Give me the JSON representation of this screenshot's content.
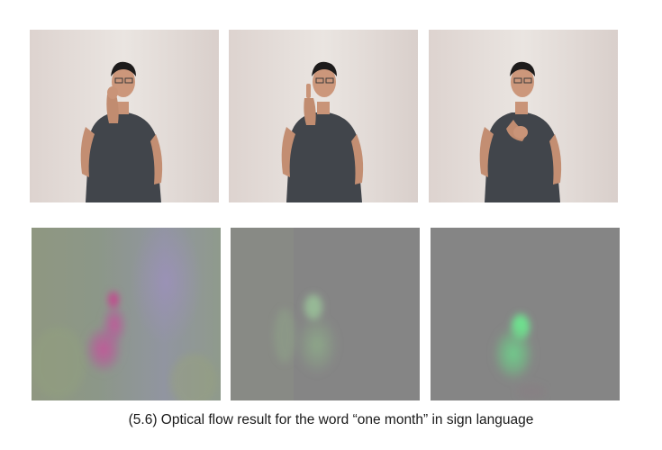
{
  "figure": {
    "caption": "(5.6) Optical flow result for the word “one month” in  sign language"
  }
}
